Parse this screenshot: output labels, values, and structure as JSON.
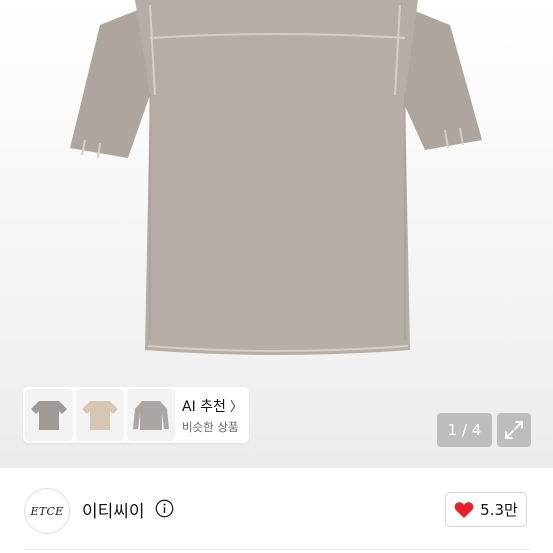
{
  "reco": {
    "title": "AI 추천",
    "subtitle": "비슷한 상품",
    "thumbnails": [
      "tshirt-grey-thumb",
      "tshirt-beige-thumb",
      "longsleeve-grey-thumb"
    ]
  },
  "gallery": {
    "counter": "1 / 4",
    "expand_icon": "expand-icon"
  },
  "store": {
    "logo_text": "ETCE",
    "name": "이티씨이",
    "info_icon": "info-icon"
  },
  "likes": {
    "count": "5.3만",
    "icon": "heart-icon",
    "color": "#e8202c"
  },
  "colors": {
    "shirt": "#b6aea6",
    "shirt_stitch": "#d6cfc6"
  }
}
